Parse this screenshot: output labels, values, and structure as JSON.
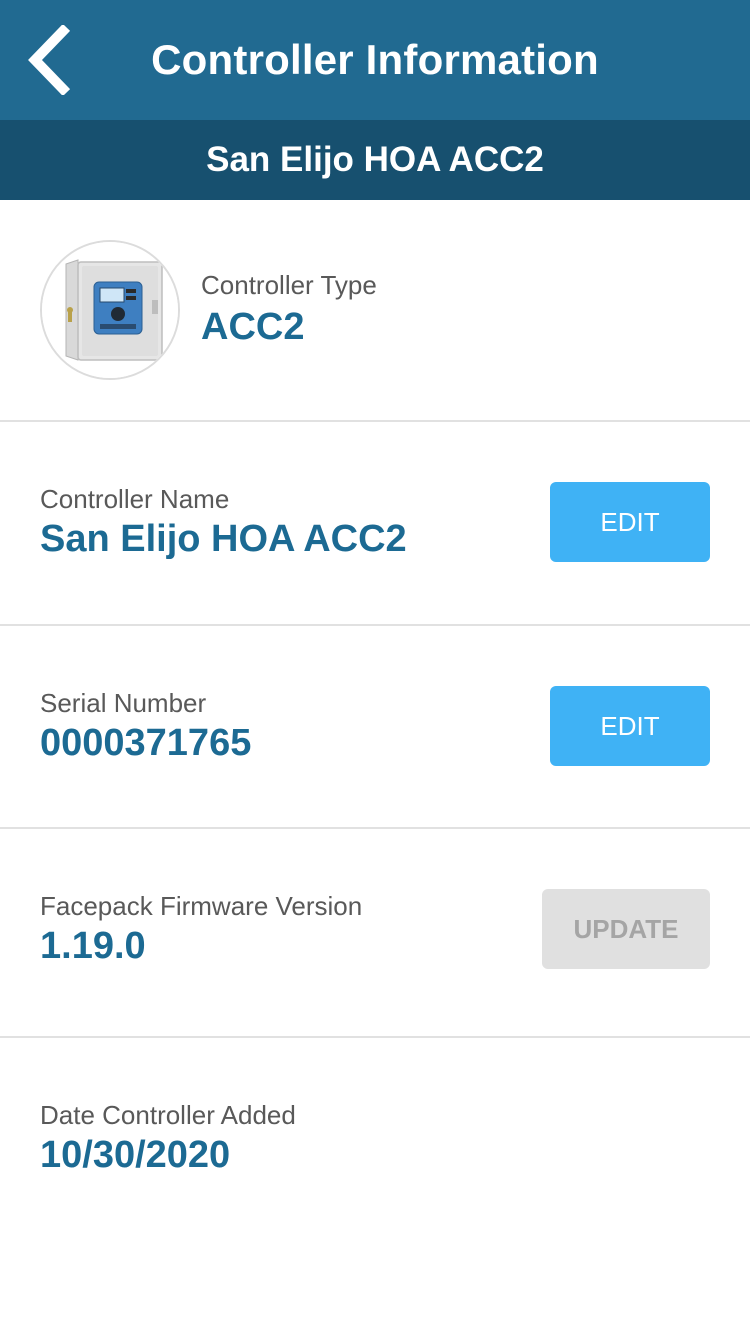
{
  "header": {
    "title": "Controller Information",
    "subtitle": "San Elijo HOA ACC2",
    "back_icon": "chevron-left-icon"
  },
  "controller_type": {
    "label": "Controller Type",
    "value": "ACC2",
    "image": "controller-device-icon"
  },
  "controller_name": {
    "label": "Controller Name",
    "value": "San Elijo HOA ACC2",
    "button_label": "EDIT"
  },
  "serial_number": {
    "label": "Serial Number",
    "value": "0000371765",
    "button_label": "EDIT"
  },
  "firmware": {
    "label": "Facepack Firmware Version",
    "value": "1.19.0",
    "button_label": "UPDATE",
    "button_disabled": true
  },
  "date_added": {
    "label": "Date Controller Added",
    "value": "10/30/2020"
  },
  "colors": {
    "header_bg": "#216a91",
    "subheader_bg": "#17506f",
    "value_text": "#1c6a93",
    "edit_button": "#3fb2f5",
    "disabled_button": "#e0e0e0"
  }
}
